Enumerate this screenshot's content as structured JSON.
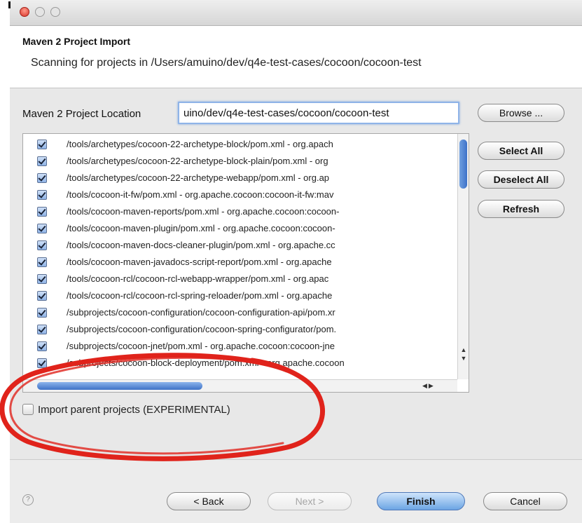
{
  "window": {
    "title": ""
  },
  "header": {
    "title": "Maven 2 Project Import",
    "message": "Scanning for projects in /Users/amuino/dev/q4e-test-cases/cocoon/cocoon-test"
  },
  "location": {
    "label": "Maven 2 Project Location",
    "value": "uino/dev/q4e-test-cases/cocoon/cocoon-test",
    "browse_label": "Browse ..."
  },
  "side_buttons": {
    "select_all": "Select All",
    "deselect_all": "Deselect All",
    "refresh": "Refresh"
  },
  "projects": [
    {
      "label": "/tools/archetypes/cocoon-22-archetype-block/pom.xml - org.apach",
      "checked": true
    },
    {
      "label": "/tools/archetypes/cocoon-22-archetype-block-plain/pom.xml - org",
      "checked": true
    },
    {
      "label": "/tools/archetypes/cocoon-22-archetype-webapp/pom.xml - org.ap",
      "checked": true
    },
    {
      "label": "/tools/cocoon-it-fw/pom.xml - org.apache.cocoon:cocoon-it-fw:mav",
      "checked": true
    },
    {
      "label": "/tools/cocoon-maven-reports/pom.xml - org.apache.cocoon:cocoon-",
      "checked": true
    },
    {
      "label": "/tools/cocoon-maven-plugin/pom.xml - org.apache.cocoon:cocoon-",
      "checked": true
    },
    {
      "label": "/tools/cocoon-maven-docs-cleaner-plugin/pom.xml - org.apache.cc",
      "checked": true
    },
    {
      "label": "/tools/cocoon-maven-javadocs-script-report/pom.xml - org.apache",
      "checked": true
    },
    {
      "label": "/tools/cocoon-rcl/cocoon-rcl-webapp-wrapper/pom.xml - org.apac",
      "checked": true
    },
    {
      "label": "/tools/cocoon-rcl/cocoon-rcl-spring-reloader/pom.xml - org.apache",
      "checked": true
    },
    {
      "label": "/subprojects/cocoon-configuration/cocoon-configuration-api/pom.xr",
      "checked": true
    },
    {
      "label": "/subprojects/cocoon-configuration/cocoon-spring-configurator/pom.",
      "checked": true
    },
    {
      "label": "/subprojects/cocoon-jnet/pom.xml - org.apache.cocoon:cocoon-jne",
      "checked": true
    },
    {
      "label": "/subprojects/cocoon-block-deployment/pom.xml - org.apache.cocoon",
      "checked": true
    }
  ],
  "import_parent": {
    "label": "Import parent projects (EXPERIMENTAL)",
    "checked": false
  },
  "footer": {
    "help_glyph": "?",
    "back_label": "< Back",
    "next_label": "Next >",
    "finish_label": "Finish",
    "cancel_label": "Cancel"
  },
  "colors": {
    "annotation_red": "#e0231b",
    "accent_blue": "#6ca5e4"
  }
}
